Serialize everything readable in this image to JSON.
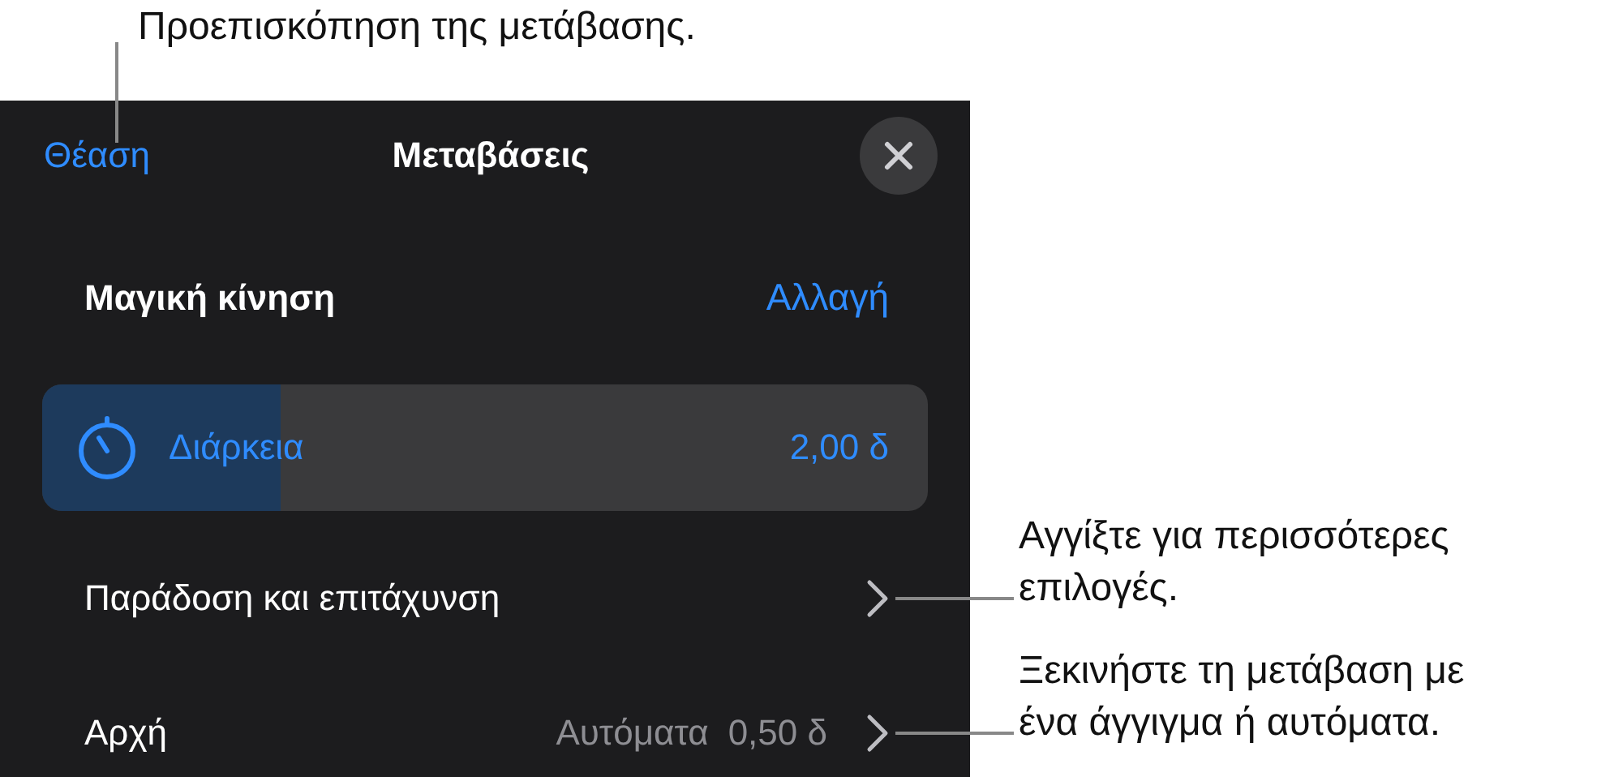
{
  "callouts": [
    {
      "lines": [
        "Προεπισκόπηση της μετάβασης."
      ]
    },
    {
      "lines": [
        "Αγγίξτε για περισσότερες",
        "επιλογές."
      ]
    },
    {
      "lines": [
        "Ξεκινήστε τη μετάβαση με",
        "ένα άγγιγμα ή αυτόματα."
      ]
    }
  ],
  "header": {
    "view_button": "Θέαση",
    "title": "Μεταβάσεις"
  },
  "transition": {
    "name": "Μαγική κίνηση",
    "change_button": "Αλλαγή"
  },
  "duration": {
    "label": "Διάρκεια",
    "value": "2,00 δ",
    "level": 0.27
  },
  "rows": [
    {
      "kind": "link",
      "label": "Παράδοση και επιτάχυνση"
    },
    {
      "kind": "value",
      "label": "Αρχή",
      "value": "Αυτόματα",
      "detail": "0,50 δ"
    }
  ]
}
